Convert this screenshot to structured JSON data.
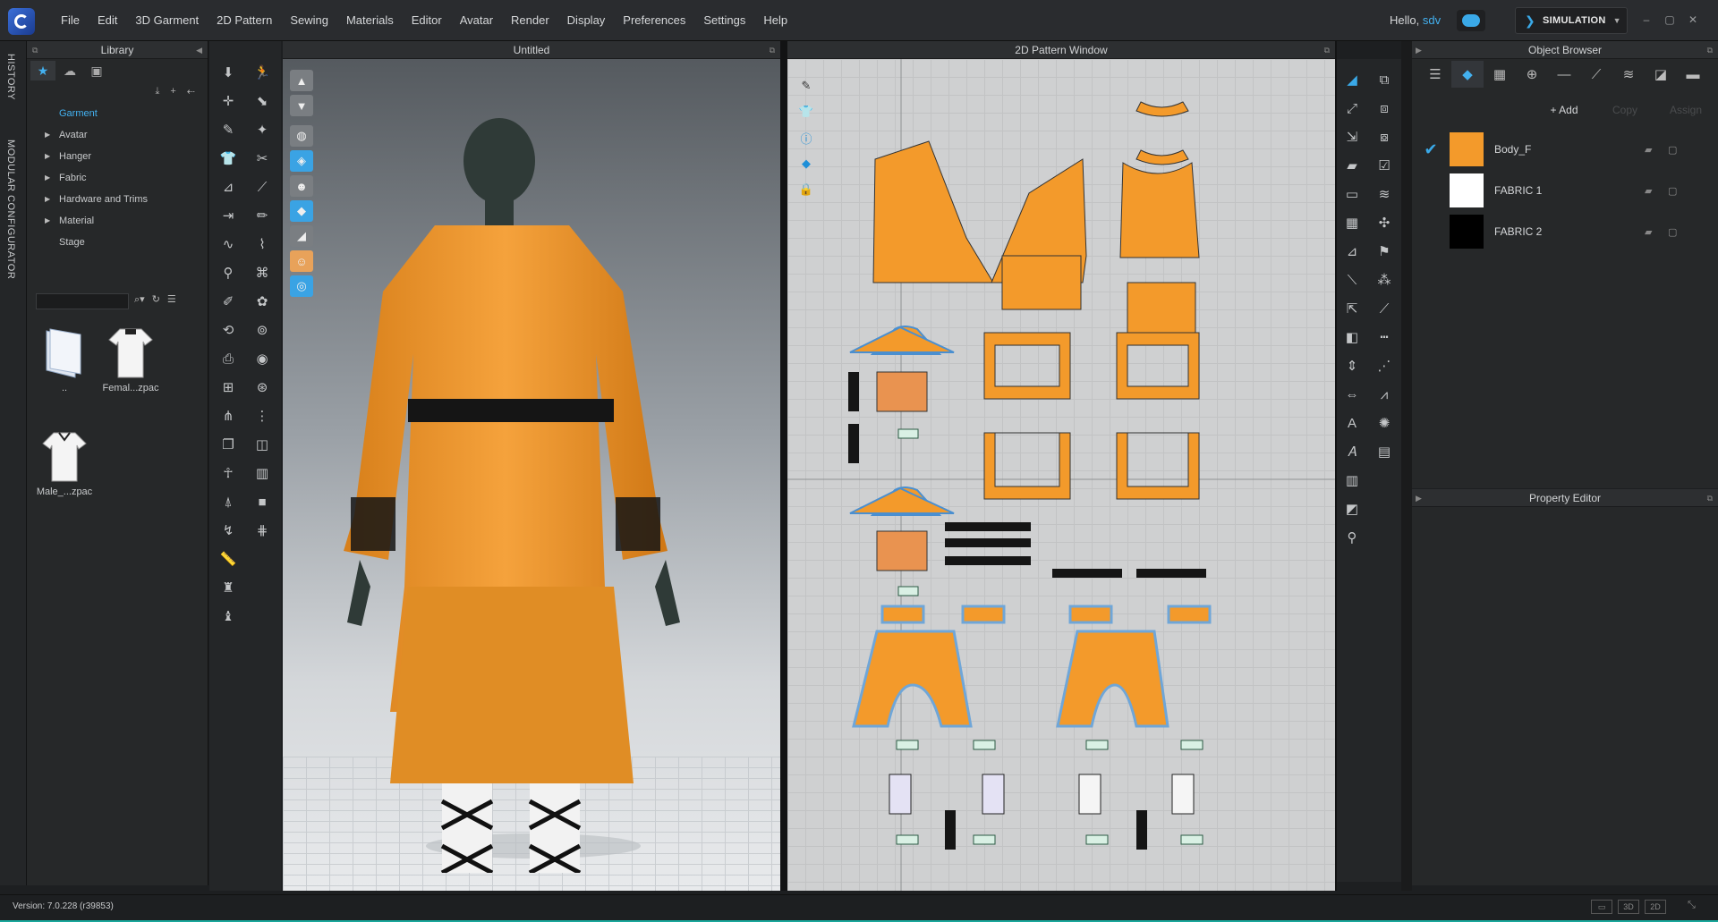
{
  "app": {
    "logo_icon": "clo-logo-icon",
    "menu": [
      "File",
      "Edit",
      "3D Garment",
      "2D Pattern",
      "Sewing",
      "Materials",
      "Editor",
      "Avatar",
      "Render",
      "Display",
      "Preferences",
      "Settings",
      "Help"
    ],
    "greeting": "Hello,",
    "user": "sdv",
    "mode": "SIMULATION",
    "accent": "#3aa9e8"
  },
  "sidebar": {
    "history": "HISTORY",
    "modular": "MODULAR CONFIGURATOR"
  },
  "library": {
    "title": "Library",
    "tree": [
      {
        "label": "Garment",
        "selected": true,
        "expandable": false
      },
      {
        "label": "Avatar",
        "selected": false,
        "expandable": true
      },
      {
        "label": "Hanger",
        "selected": false,
        "expandable": true
      },
      {
        "label": "Fabric",
        "selected": false,
        "expandable": true
      },
      {
        "label": "Hardware and Trims",
        "selected": false,
        "expandable": true
      },
      {
        "label": "Material",
        "selected": false,
        "expandable": true
      },
      {
        "label": "Stage",
        "selected": false,
        "expandable": false
      }
    ],
    "search_value": "",
    "files": [
      {
        "label": "..",
        "icon": "folder-icon"
      },
      {
        "label": "Femal...zpac",
        "icon": "female-shirt-icon"
      },
      {
        "label": "Male_...zpac",
        "icon": "male-shirt-icon"
      }
    ]
  },
  "window3d": {
    "title": "Untitled"
  },
  "window2d": {
    "title": "2D Pattern Window"
  },
  "object_browser": {
    "title": "Object Browser",
    "add": "+ Add",
    "copy": "Copy",
    "assign": "Assign",
    "fabrics": [
      {
        "name": "Body_F",
        "color": "#f39a2b",
        "checked": true
      },
      {
        "name": "FABRIC 1",
        "color": "#ffffff",
        "checked": false
      },
      {
        "name": "FABRIC 2",
        "color": "#000000",
        "checked": false
      }
    ]
  },
  "property_editor": {
    "title": "Property Editor"
  },
  "status": {
    "version": "Version: 7.0.228 (r39853)",
    "view_3d": "3D",
    "view_2d": "2D"
  },
  "colors": {
    "garment": "#f39a2b",
    "avatar": "#2f3a37",
    "highlight": "#3aa3e4"
  }
}
